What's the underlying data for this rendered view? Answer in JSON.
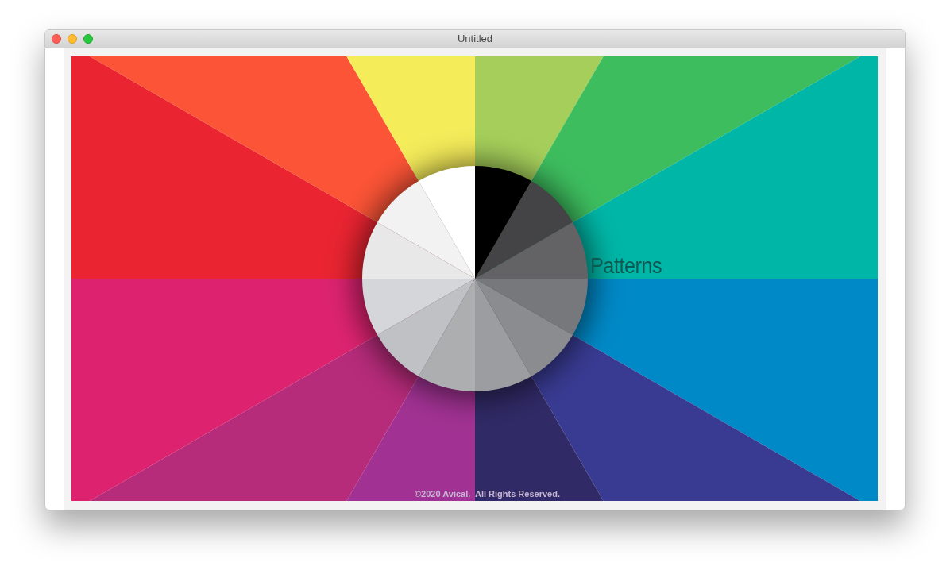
{
  "window": {
    "title": "Untitled"
  },
  "page": {
    "heading": "Patterns",
    "footer": "©2020 Avical.  All Rights Reserved."
  }
}
